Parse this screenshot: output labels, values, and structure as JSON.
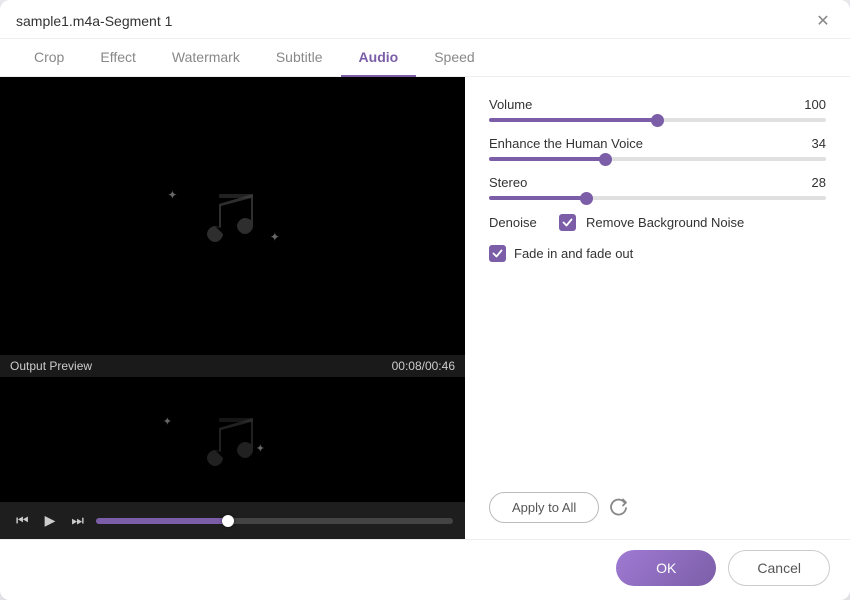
{
  "title": "sample1.m4a-Segment 1",
  "tabs": [
    {
      "id": "crop",
      "label": "Crop",
      "active": false
    },
    {
      "id": "effect",
      "label": "Effect",
      "active": false
    },
    {
      "id": "watermark",
      "label": "Watermark",
      "active": false
    },
    {
      "id": "subtitle",
      "label": "Subtitle",
      "active": false
    },
    {
      "id": "audio",
      "label": "Audio",
      "active": true
    },
    {
      "id": "speed",
      "label": "Speed",
      "active": false
    }
  ],
  "preview": {
    "output_label": "Output Preview",
    "timestamp": "00:08/00:46"
  },
  "audio": {
    "volume_label": "Volume",
    "volume_value": "100",
    "volume_pct": 100,
    "enhance_label": "Enhance the Human Voice",
    "enhance_value": "34",
    "enhance_pct": 34,
    "stereo_label": "Stereo",
    "stereo_value": "28",
    "stereo_pct": 28,
    "denoise_label": "Denoise",
    "remove_bg_label": "Remove Background Noise",
    "remove_bg_checked": true,
    "fade_label": "Fade in and fade out",
    "fade_checked": true
  },
  "actions": {
    "apply_all_label": "Apply to All",
    "reset_label": "↺"
  },
  "footer": {
    "ok_label": "OK",
    "cancel_label": "Cancel"
  }
}
